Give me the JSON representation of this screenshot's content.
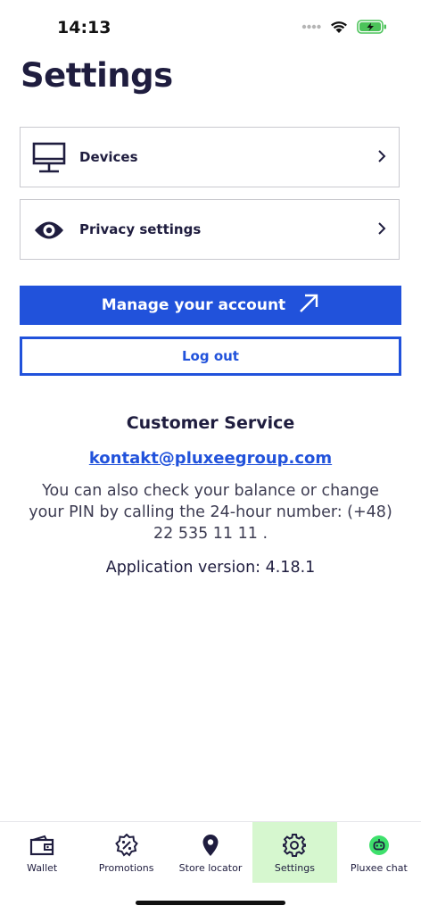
{
  "status": {
    "time": "14:13"
  },
  "page": {
    "title": "Settings"
  },
  "menu": [
    {
      "label": "Devices",
      "icon": "monitor-icon"
    },
    {
      "label": "Privacy settings",
      "icon": "eye-icon"
    }
  ],
  "actions": {
    "manage_account": "Manage your account",
    "logout": "Log out"
  },
  "customer_service": {
    "title": "Customer Service",
    "email": "kontakt@pluxeegroup.com",
    "info": "You can also check your balance or change your PIN by calling the 24-hour number: (+48) 22 535 11 11 .",
    "version": "Application version: 4.18.1"
  },
  "tabs": [
    {
      "label": "Wallet",
      "icon": "wallet-icon"
    },
    {
      "label": "Promotions",
      "icon": "percent-badge-icon"
    },
    {
      "label": "Store locator",
      "icon": "map-pin-icon"
    },
    {
      "label": "Settings",
      "icon": "gear-icon",
      "active": true
    },
    {
      "label": "Pluxee chat",
      "icon": "chat-bot-icon"
    }
  ],
  "colors": {
    "primary": "#2152db",
    "text": "#1f1d3f",
    "active_tab": "#d6f7cf",
    "chat_green": "#3ee06c"
  }
}
